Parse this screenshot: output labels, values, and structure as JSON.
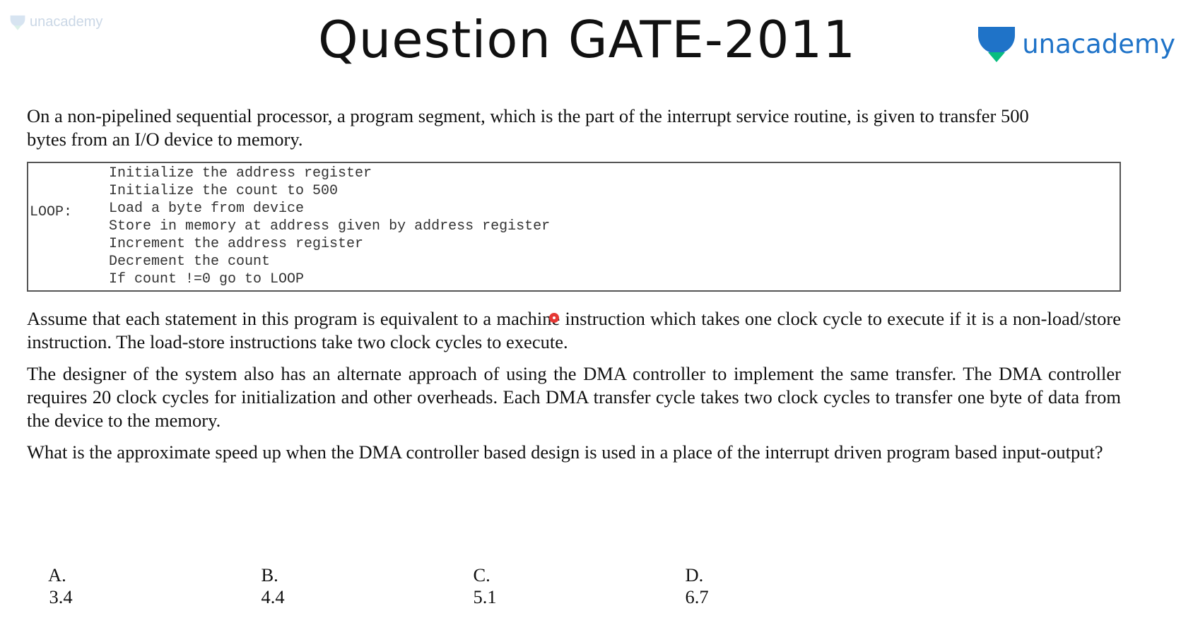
{
  "watermark": {
    "text": "unacademy"
  },
  "header": {
    "title": "Question GATE-2011",
    "brand": "unacademy"
  },
  "question": {
    "intro": "On a non-pipelined sequential processor, a program segment, which is the part of the interrupt service routine, is given to transfer 500 bytes from an I/O device to memory.",
    "code": {
      "label": "LOOP:",
      "lines": [
        "Initialize the address register",
        "Initialize the count to 500",
        "Load a byte from device",
        "Store in memory at address given by address register",
        "Increment the address register",
        "Decrement the count",
        "If count !=0 go to LOOP"
      ]
    },
    "para1": "Assume that each statement in this program is equivalent to a machine instruction which takes one clock cycle to execute if it is a non-load/store instruction. The load-store instructions take two clock cycles to execute.",
    "para2": "The designer of the system also has an alternate approach of using the DMA controller to implement the same transfer. The DMA controller requires 20 clock cycles for initialization and other overheads. Each DMA transfer cycle takes two clock cycles to transfer one byte of data from the device to the memory.",
    "para3": "What is the approximate speed up when the DMA controller based design is used in a place of the interrupt driven program based input-output?"
  },
  "options": [
    {
      "letter": "A.",
      "value": "3.4"
    },
    {
      "letter": "B.",
      "value": "4.4"
    },
    {
      "letter": "C.",
      "value": "5.1"
    },
    {
      "letter": "D.",
      "value": "6.7"
    }
  ],
  "colors": {
    "brand_blue": "#1f73c8",
    "brand_green": "#08bd80",
    "cursor_red": "#e53935"
  }
}
